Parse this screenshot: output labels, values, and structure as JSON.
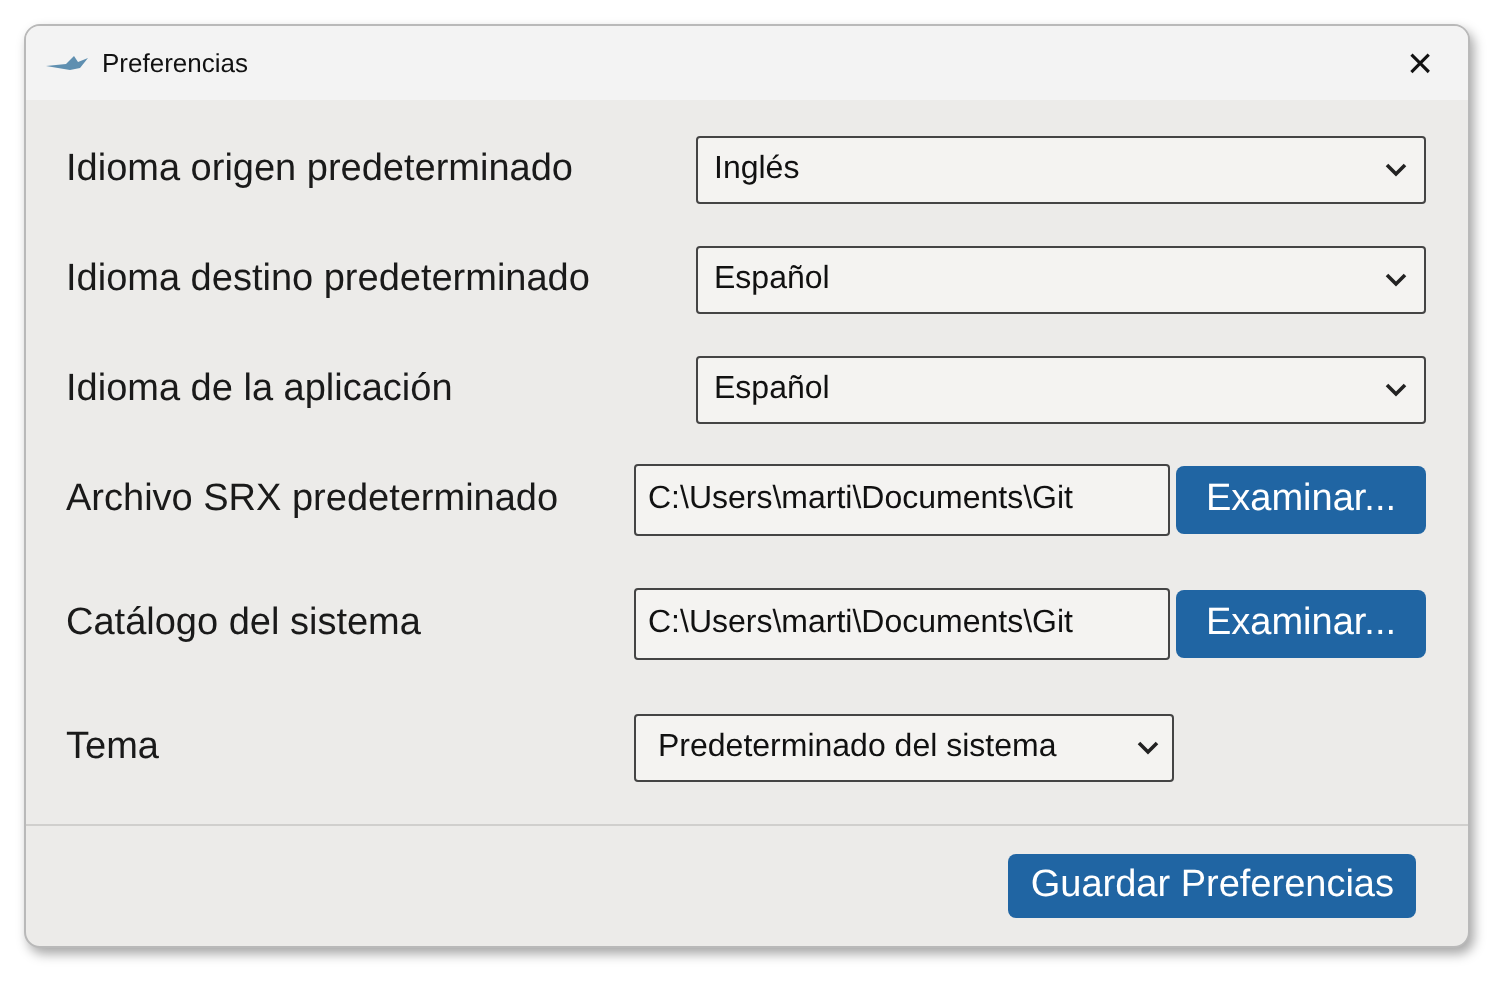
{
  "window": {
    "title": "Preferencias",
    "close": "×"
  },
  "settings": [
    {
      "kind": "dropdown",
      "label": "Idioma origen predeterminado",
      "value": "Inglés"
    },
    {
      "kind": "dropdown",
      "label": "Idioma destino predeterminado",
      "value": "Español"
    },
    {
      "kind": "dropdown",
      "label": "Idioma de la aplicación",
      "value": "Español"
    },
    {
      "kind": "file",
      "label": "Archivo SRX predeterminado",
      "value": "C:\\Users\\marti\\Documents\\Git",
      "button": "Examinar..."
    },
    {
      "kind": "file",
      "label": "Catálogo del sistema",
      "value": "C:\\Users\\marti\\Documents\\Git",
      "button": "Examinar..."
    },
    {
      "kind": "short-dropdown",
      "label": "Tema",
      "value": "Predeterminado del sistema"
    }
  ],
  "save_button": "Guardar Preferencias"
}
